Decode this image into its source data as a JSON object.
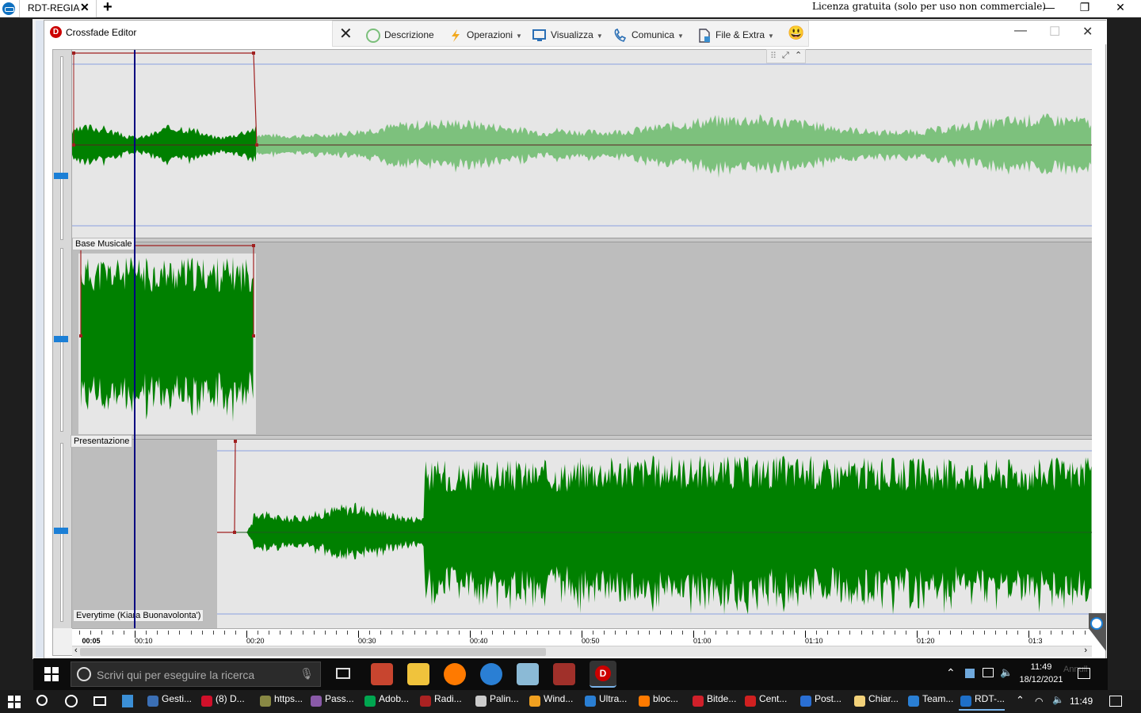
{
  "remote": {
    "tab_title": "RDT-REGIA",
    "tab_close": "✕",
    "new_tab": "+",
    "license": "Licenza gratuita (solo per uso non commerciale)",
    "minimize": "—",
    "restore": "❐",
    "close": "✕"
  },
  "editor_window": {
    "title": "Crossfade Editor",
    "logo_letter": "D",
    "minimize": "—",
    "maximize": "☐",
    "close": "✕"
  },
  "toolbar": {
    "close_glyph": "✕",
    "descrizione": "Descrizione",
    "operazioni": "Operazioni",
    "visualizza": "Visualizza",
    "comunica": "Comunica",
    "file_extra": "File & Extra",
    "smiley": "😃"
  },
  "tracks": [
    {
      "label": ""
    },
    {
      "label": "Base Musicale"
    },
    {
      "label": "Presentazione"
    },
    {
      "label": "Everytime (Kiara Buonavolonta')"
    }
  ],
  "ruler": {
    "current": "00:05",
    "labels": [
      "00:10",
      "00:20",
      "00:30",
      "00:40",
      "00:50",
      "01:00",
      "01:10",
      "01:20",
      "01:3"
    ]
  },
  "colors": {
    "wave_dark": "#008000",
    "wave_light": "#7dc17d",
    "envelope": "#a02020",
    "cursor": "#000080",
    "accent": "#1b7fd6"
  },
  "taskbar_inner": {
    "search_placeholder": "Scrivi qui per eseguire la ricerca",
    "time": "11:49",
    "date": "18/12/2021",
    "partial_text": "Annull"
  },
  "taskbar_outer": {
    "items": [
      {
        "label": "Gesti...",
        "color": "#3b6fb5"
      },
      {
        "label": "(8) D...",
        "color": "#d0102a"
      },
      {
        "label": "https...",
        "color": "#888844"
      },
      {
        "label": "Pass...",
        "color": "#8a5aa8"
      },
      {
        "label": "Adob...",
        "color": "#00a650"
      },
      {
        "label": "Radi...",
        "color": "#aa2222"
      },
      {
        "label": "Palin...",
        "color": "#cccccc"
      },
      {
        "label": "Wind...",
        "color": "#f0a020"
      },
      {
        "label": "Ultra...",
        "color": "#2a7fd4"
      },
      {
        "label": "bloc...",
        "color": "#ff7a00"
      },
      {
        "label": "Bitde...",
        "color": "#d0202a"
      },
      {
        "label": "Cent...",
        "color": "#d02020"
      },
      {
        "label": "Post...",
        "color": "#2a6fd4"
      },
      {
        "label": "Chiar...",
        "color": "#f3d27a"
      },
      {
        "label": "Team...",
        "color": "#2a7fd4"
      },
      {
        "label": "RDT-...",
        "color": "#1e6fc8"
      }
    ],
    "time": "11:49"
  }
}
